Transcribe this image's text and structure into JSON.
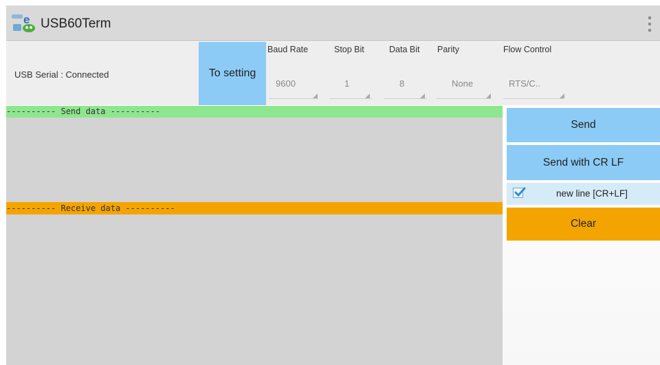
{
  "app": {
    "title": "USB60Term",
    "icon": "usb-app-icon",
    "menu_icon": "overflow-menu-icon"
  },
  "status": {
    "text": "USB Serial : Connected"
  },
  "settings_button": {
    "label": "To setting"
  },
  "params": {
    "baud_rate": {
      "label": "Baud Rate",
      "value": "9600"
    },
    "stop_bit": {
      "label": "Stop Bit",
      "value": "1"
    },
    "data_bit": {
      "label": "Data Bit",
      "value": "8"
    },
    "parity": {
      "label": "Parity",
      "value": "None"
    },
    "flow_control": {
      "label": "Flow Control",
      "value": "RTS/C.."
    }
  },
  "send_section": {
    "header": "---------- Send data ----------"
  },
  "receive_section": {
    "header": "---------- Receive data ----------"
  },
  "buttons": {
    "send": "Send",
    "send_crlf": "Send with CR LF",
    "clear": "Clear"
  },
  "newline": {
    "label": "new line [CR+LF]",
    "checked": true
  },
  "colors": {
    "accent_blue": "#8ccbf5",
    "send_green": "#8ee68e",
    "receive_orange": "#f4a400",
    "area_gray": "#d3d3d3"
  }
}
